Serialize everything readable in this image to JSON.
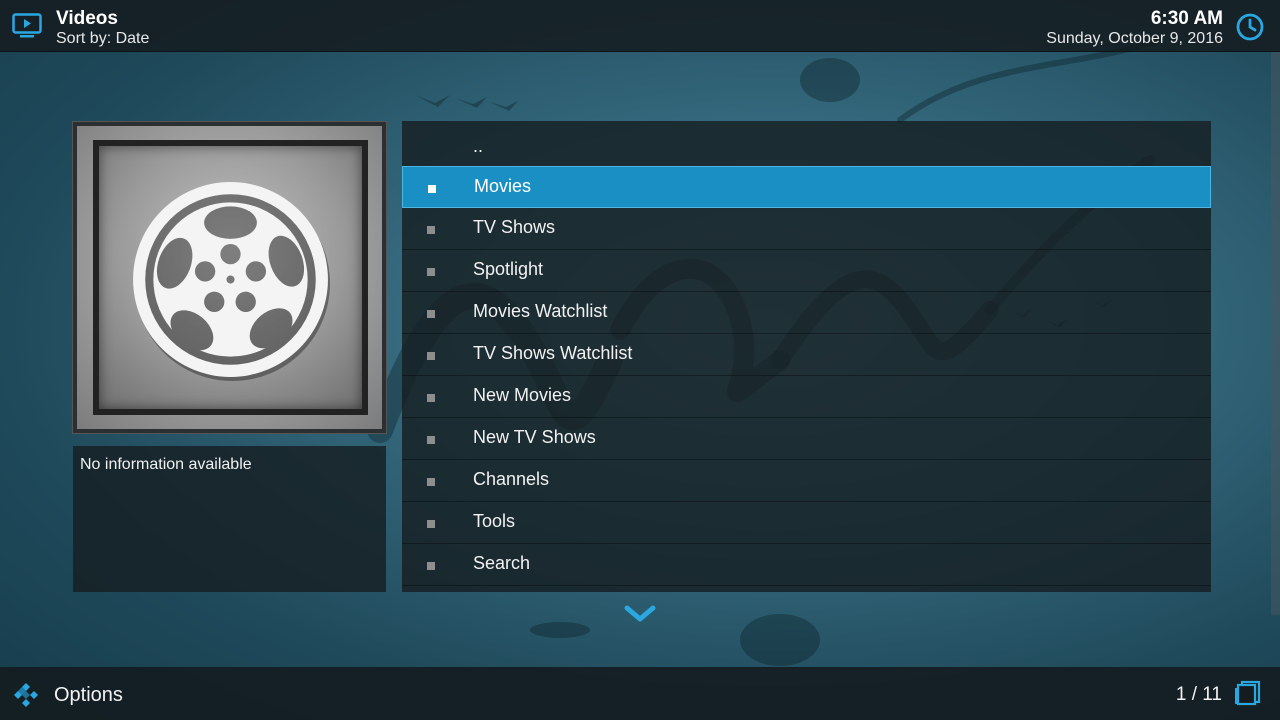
{
  "header": {
    "title": "Videos",
    "subtitle": "Sort by: Date",
    "time": "6:30 AM",
    "date": "Sunday, October 9, 2016",
    "icons": {
      "section": "tv-icon",
      "clock": "clock-icon"
    }
  },
  "info": {
    "text": "No information available"
  },
  "list": {
    "items": [
      {
        "label": ".."
      },
      {
        "label": "Movies"
      },
      {
        "label": "TV Shows"
      },
      {
        "label": "Spotlight"
      },
      {
        "label": "Movies Watchlist"
      },
      {
        "label": "TV Shows Watchlist"
      },
      {
        "label": "New Movies"
      },
      {
        "label": "New TV Shows"
      },
      {
        "label": "Channels"
      },
      {
        "label": "Tools"
      },
      {
        "label": "Search"
      }
    ],
    "selected_index": 1
  },
  "footer": {
    "options_label": "Options",
    "page_count": "1 / 11"
  },
  "colors": {
    "accent": "#1a8fc4",
    "icon_blue": "#2aa7e0",
    "bar_bg": "#141c20"
  }
}
